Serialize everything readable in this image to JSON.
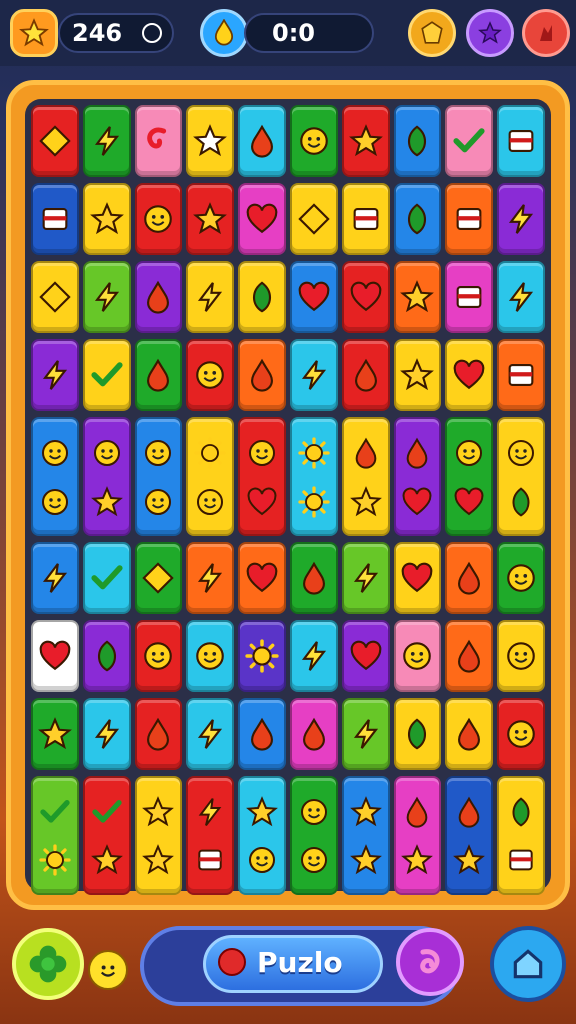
{
  "hud": {
    "score": "246",
    "score_icon": "star-icon",
    "timer": "0:0",
    "timer_icon": "flame-drop-icon",
    "right_buttons": [
      "badge-icon",
      "star-badge-icon",
      "fire-icon"
    ]
  },
  "board": {
    "columns": 10,
    "rows": [
      {
        "tall": false,
        "tiles": [
          {
            "color": "#e52222",
            "icon": "diamond"
          },
          {
            "color": "#1faa2a",
            "icon": "bolt"
          },
          {
            "color": "#f78ab7",
            "icon": "curl"
          },
          {
            "color": "#ffd21a",
            "icon": "star-outline"
          },
          {
            "color": "#2bc6ea",
            "icon": "drop"
          },
          {
            "color": "#1faa2a",
            "icon": "face"
          },
          {
            "color": "#e52222",
            "icon": "star"
          },
          {
            "color": "#2486e8",
            "icon": "leaf"
          },
          {
            "color": "#f78ab7",
            "icon": "check"
          },
          {
            "color": "#2bc6ea",
            "icon": "square"
          }
        ]
      },
      {
        "tall": false,
        "tiles": [
          {
            "color": "#2059c8",
            "icon": "square"
          },
          {
            "color": "#ffd21a",
            "icon": "star"
          },
          {
            "color": "#e52222",
            "icon": "face"
          },
          {
            "color": "#e52222",
            "icon": "star"
          },
          {
            "color": "#e63fc4",
            "icon": "heart"
          },
          {
            "color": "#ffd21a",
            "icon": "diamond"
          },
          {
            "color": "#ffd21a",
            "icon": "square"
          },
          {
            "color": "#2486e8",
            "icon": "leaf"
          },
          {
            "color": "#ff6a18",
            "icon": "square"
          },
          {
            "color": "#8a2bd6",
            "icon": "bolt"
          }
        ]
      },
      {
        "tall": false,
        "tiles": [
          {
            "color": "#ffd21a",
            "icon": "diamond"
          },
          {
            "color": "#67c728",
            "icon": "bolt"
          },
          {
            "color": "#8a2bd6",
            "icon": "drop"
          },
          {
            "color": "#ffd21a",
            "icon": "bolt"
          },
          {
            "color": "#ffd21a",
            "icon": "leaf"
          },
          {
            "color": "#2486e8",
            "icon": "heart"
          },
          {
            "color": "#e52222",
            "icon": "heart"
          },
          {
            "color": "#ff6a18",
            "icon": "star"
          },
          {
            "color": "#e63fc4",
            "icon": "square"
          },
          {
            "color": "#2bc6ea",
            "icon": "bolt"
          }
        ]
      },
      {
        "tall": false,
        "tiles": [
          {
            "color": "#8a2bd6",
            "icon": "bolt"
          },
          {
            "color": "#ffd21a",
            "icon": "check"
          },
          {
            "color": "#1faa2a",
            "icon": "drop"
          },
          {
            "color": "#e52222",
            "icon": "face"
          },
          {
            "color": "#ff6a18",
            "icon": "drop"
          },
          {
            "color": "#2bc6ea",
            "icon": "bolt"
          },
          {
            "color": "#e52222",
            "icon": "drop"
          },
          {
            "color": "#ffd21a",
            "icon": "star"
          },
          {
            "color": "#ffd21a",
            "icon": "heart"
          },
          {
            "color": "#ff6a18",
            "icon": "square"
          }
        ]
      },
      {
        "tall": true,
        "tiles": [
          {
            "color": "#2486e8",
            "icon": "face",
            "icon2": "face"
          },
          {
            "color": "#8a2bd6",
            "icon": "face",
            "icon2": "star"
          },
          {
            "color": "#2486e8",
            "icon": "face",
            "icon2": "face"
          },
          {
            "color": "#ffd21a",
            "icon": "sun",
            "icon2": "face"
          },
          {
            "color": "#e52222",
            "icon": "face",
            "icon2": "heart"
          },
          {
            "color": "#2bc6ea",
            "icon": "sun",
            "icon2": "sun"
          },
          {
            "color": "#ffd21a",
            "icon": "drop",
            "icon2": "star"
          },
          {
            "color": "#8a2bd6",
            "icon": "drop",
            "icon2": "heart"
          },
          {
            "color": "#1faa2a",
            "icon": "face",
            "icon2": "heart"
          },
          {
            "color": "#ffd21a",
            "icon": "face",
            "icon2": "leaf"
          }
        ]
      },
      {
        "tall": false,
        "tiles": [
          {
            "color": "#2486e8",
            "icon": "bolt"
          },
          {
            "color": "#2bc6ea",
            "icon": "check"
          },
          {
            "color": "#1faa2a",
            "icon": "diamond"
          },
          {
            "color": "#ff6a18",
            "icon": "bolt"
          },
          {
            "color": "#ff6a18",
            "icon": "heart"
          },
          {
            "color": "#1faa2a",
            "icon": "drop"
          },
          {
            "color": "#67c728",
            "icon": "bolt"
          },
          {
            "color": "#ffd21a",
            "icon": "heart"
          },
          {
            "color": "#ff6a18",
            "icon": "drop"
          },
          {
            "color": "#1faa2a",
            "icon": "face"
          }
        ]
      },
      {
        "tall": false,
        "tiles": [
          {
            "color": "#ffffff",
            "icon": "heart"
          },
          {
            "color": "#8a2bd6",
            "icon": "leaf"
          },
          {
            "color": "#e52222",
            "icon": "face"
          },
          {
            "color": "#2bc6ea",
            "icon": "face"
          },
          {
            "color": "#5a34c8",
            "icon": "sun"
          },
          {
            "color": "#2bc6ea",
            "icon": "bolt"
          },
          {
            "color": "#8a2bd6",
            "icon": "heart"
          },
          {
            "color": "#f78ab7",
            "icon": "face"
          },
          {
            "color": "#ff6a18",
            "icon": "drop"
          },
          {
            "color": "#ffd21a",
            "icon": "face"
          }
        ]
      },
      {
        "tall": false,
        "tiles": [
          {
            "color": "#1faa2a",
            "icon": "star"
          },
          {
            "color": "#2bc6ea",
            "icon": "bolt"
          },
          {
            "color": "#e52222",
            "icon": "drop"
          },
          {
            "color": "#2bc6ea",
            "icon": "bolt"
          },
          {
            "color": "#2486e8",
            "icon": "drop"
          },
          {
            "color": "#e63fc4",
            "icon": "drop"
          },
          {
            "color": "#67c728",
            "icon": "bolt"
          },
          {
            "color": "#ffd21a",
            "icon": "leaf"
          },
          {
            "color": "#ffd21a",
            "icon": "drop"
          },
          {
            "color": "#e52222",
            "icon": "face"
          }
        ]
      },
      {
        "tall": true,
        "tiles": [
          {
            "color": "#67c728",
            "icon": "check",
            "icon2": "sun"
          },
          {
            "color": "#e52222",
            "icon": "check",
            "icon2": "star"
          },
          {
            "color": "#ffd21a",
            "icon": "star",
            "icon2": "star"
          },
          {
            "color": "#e52222",
            "icon": "bolt",
            "icon2": "square"
          },
          {
            "color": "#2bc6ea",
            "icon": "star",
            "icon2": "face"
          },
          {
            "color": "#1faa2a",
            "icon": "face",
            "icon2": "face"
          },
          {
            "color": "#2486e8",
            "icon": "star",
            "icon2": "star"
          },
          {
            "color": "#e63fc4",
            "icon": "drop",
            "icon2": "star"
          },
          {
            "color": "#2059c8",
            "icon": "drop",
            "icon2": "star"
          },
          {
            "color": "#ffd21a",
            "icon": "leaf",
            "icon2": "square"
          }
        ]
      }
    ]
  },
  "bottom": {
    "puzzle_label": "Puzlo",
    "left_button_icon": "flower-icon",
    "smiley_icon": "smiley-icon",
    "right_button_icon": "swirl-icon",
    "home_icon": "home-icon"
  }
}
